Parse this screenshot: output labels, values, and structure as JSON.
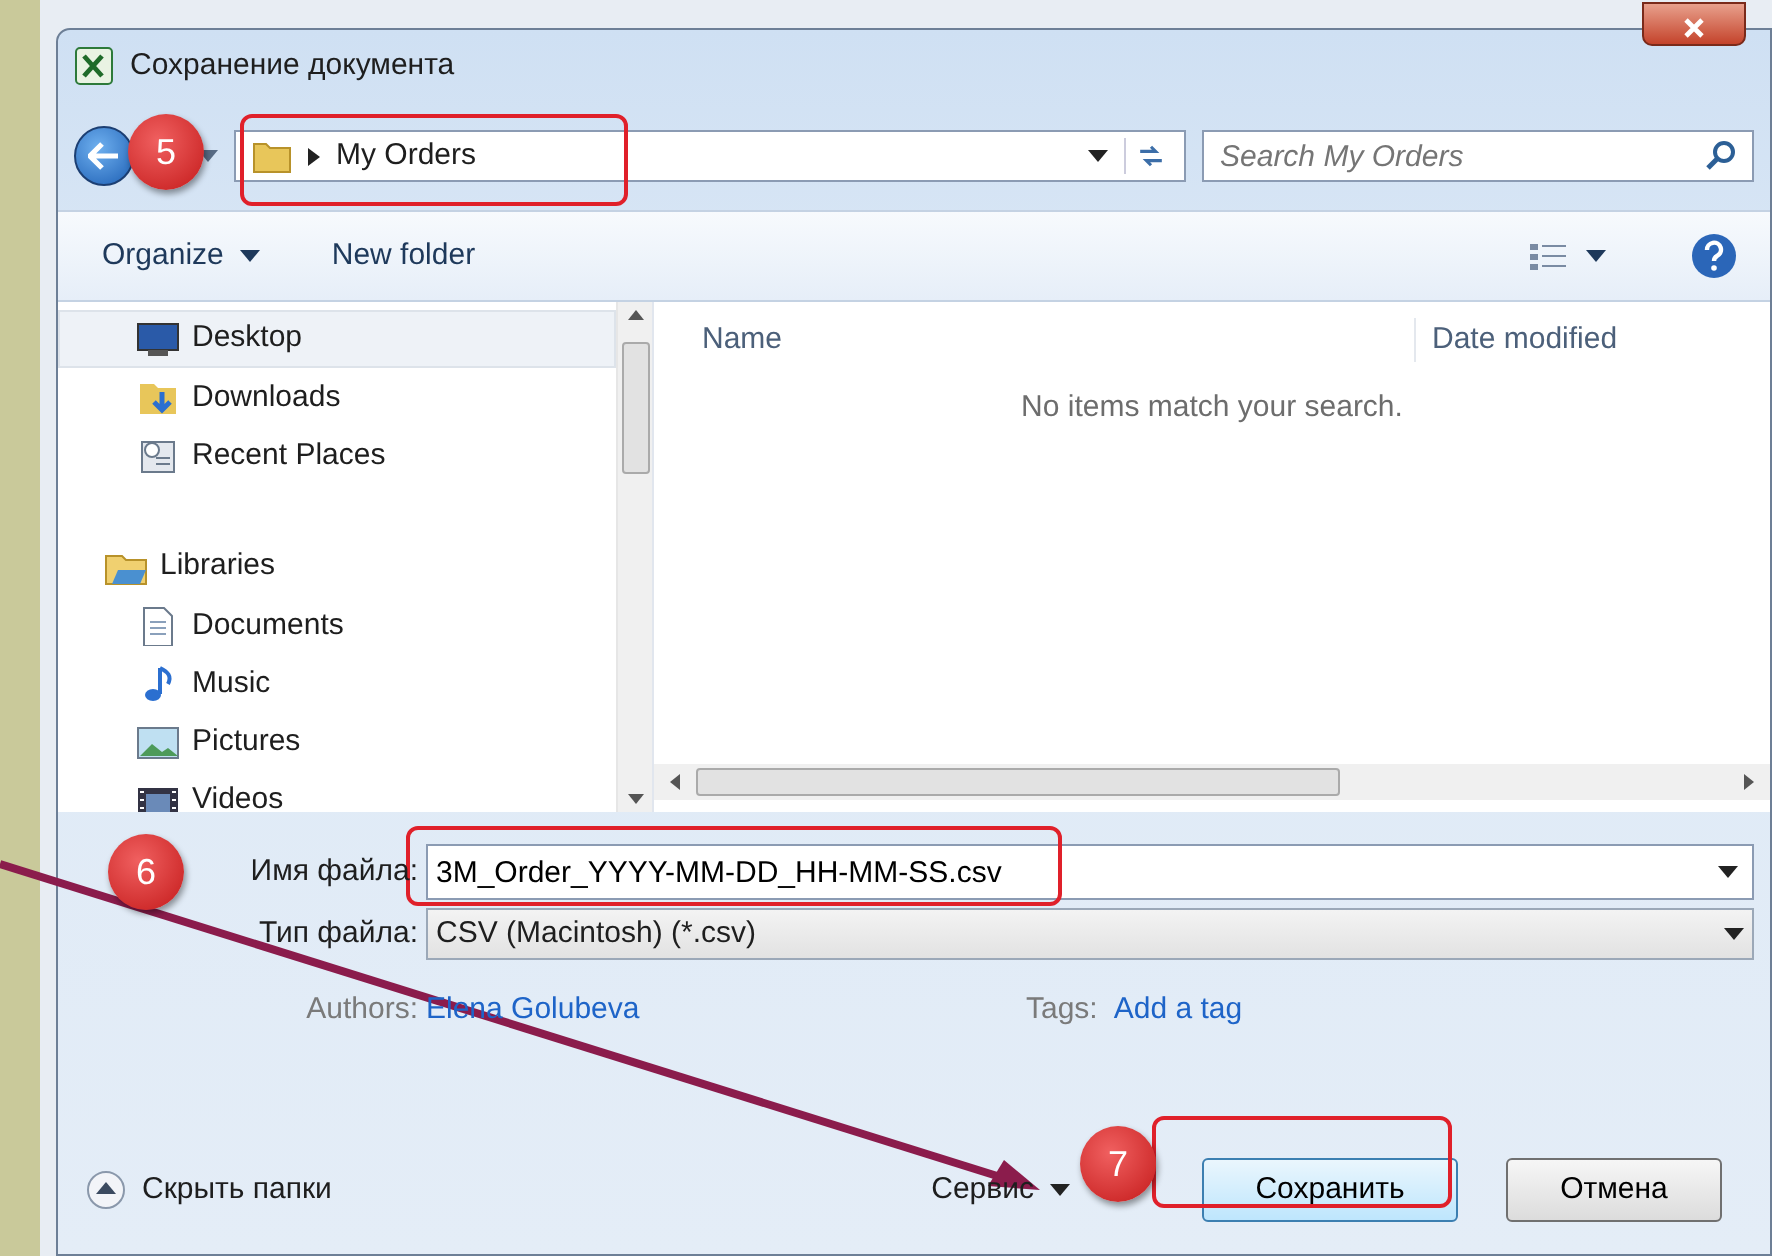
{
  "window": {
    "title": "Сохранение документа"
  },
  "address_bar": {
    "path": "My Orders"
  },
  "search": {
    "placeholder": "Search My Orders"
  },
  "toolbar": {
    "organize": "Organize",
    "new_folder": "New folder"
  },
  "nav_pane": [
    {
      "label": "Desktop",
      "kind": "desktop",
      "selected": true
    },
    {
      "label": "Downloads",
      "kind": "downloads",
      "selected": false
    },
    {
      "label": "Recent Places",
      "kind": "recent",
      "selected": false
    },
    {
      "label": "Libraries",
      "kind": "libraries",
      "selected": false
    },
    {
      "label": "Documents",
      "kind": "documents",
      "selected": false
    },
    {
      "label": "Music",
      "kind": "music",
      "selected": false
    },
    {
      "label": "Pictures",
      "kind": "pictures",
      "selected": false
    },
    {
      "label": "Videos",
      "kind": "videos",
      "selected": false
    }
  ],
  "file_list": {
    "columns": [
      "Name",
      "Date modified"
    ],
    "empty_message": "No items match your search."
  },
  "file_name": {
    "label": "Имя файла:",
    "value": "3M_Order_YYYY-MM-DD_HH-MM-SS.csv"
  },
  "file_type": {
    "label": "Тип файла:",
    "value": "CSV (Macintosh) (*.csv)"
  },
  "authors": {
    "label": "Authors:",
    "value": "Elena Golubeva"
  },
  "tags": {
    "label": "Tags:",
    "value": "Add a tag"
  },
  "hide_folders": "Скрыть папки",
  "tools": "Сервис",
  "buttons": [
    "Сохранить",
    "Отмена"
  ],
  "step_badges": [
    "5",
    "6",
    "7"
  ]
}
